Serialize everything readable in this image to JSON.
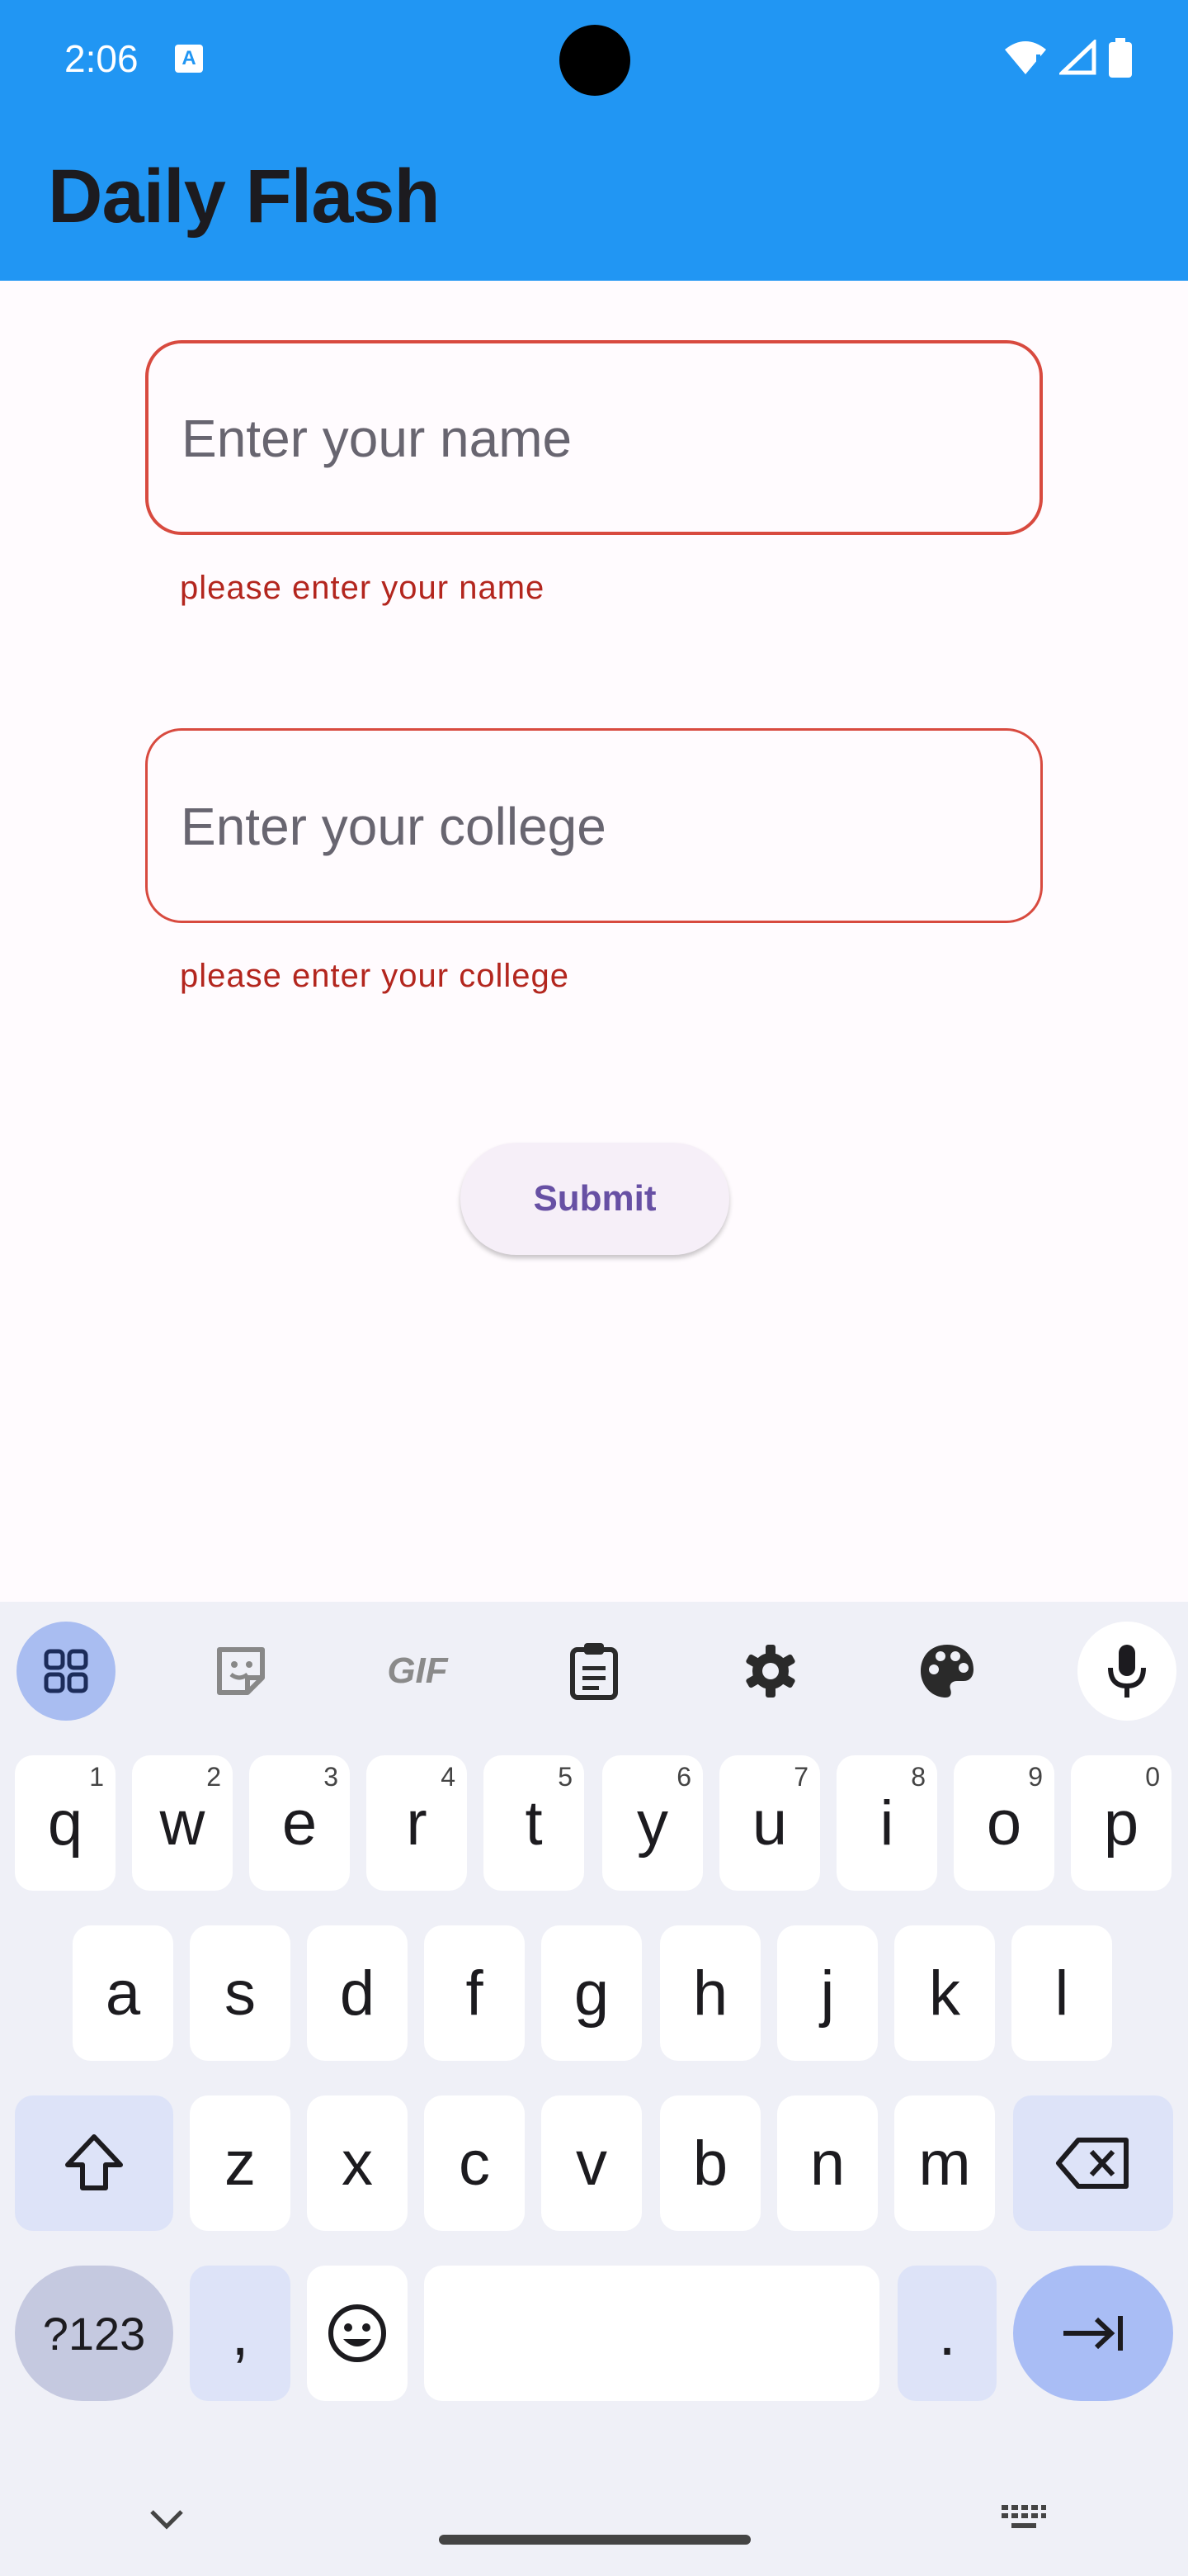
{
  "status_bar": {
    "time": "2:06"
  },
  "app_bar": {
    "title": "Daily Flash"
  },
  "form": {
    "name": {
      "value": "",
      "placeholder": "Enter your name",
      "error": "please enter your name"
    },
    "college": {
      "value": "",
      "placeholder": "Enter your college",
      "error": "please enter your college"
    },
    "submit_label": "Submit"
  },
  "keyboard": {
    "toolbar_icons": [
      "apps-grid-icon",
      "sticker-icon",
      "gif-icon",
      "clipboard-icon",
      "settings-gear-icon",
      "palette-icon",
      "microphone-icon"
    ],
    "toolbar_gif_label": "GIF",
    "row1": [
      {
        "key": "q",
        "hint": "1"
      },
      {
        "key": "w",
        "hint": "2"
      },
      {
        "key": "e",
        "hint": "3"
      },
      {
        "key": "r",
        "hint": "4"
      },
      {
        "key": "t",
        "hint": "5"
      },
      {
        "key": "y",
        "hint": "6"
      },
      {
        "key": "u",
        "hint": "7"
      },
      {
        "key": "i",
        "hint": "8"
      },
      {
        "key": "o",
        "hint": "9"
      },
      {
        "key": "p",
        "hint": "0"
      }
    ],
    "row2": [
      "a",
      "s",
      "d",
      "f",
      "g",
      "h",
      "j",
      "k",
      "l"
    ],
    "row3": [
      "z",
      "x",
      "c",
      "v",
      "b",
      "n",
      "m"
    ],
    "symbols_label": "?123",
    "comma": ",",
    "period": "."
  },
  "colors": {
    "app_bar": "#2196f3",
    "error": "#b3261e",
    "field_border": "#d84a3f",
    "submit_text": "#6750a4",
    "keyboard_bg": "#eff0f7",
    "enter_key": "#a9bdf5"
  }
}
